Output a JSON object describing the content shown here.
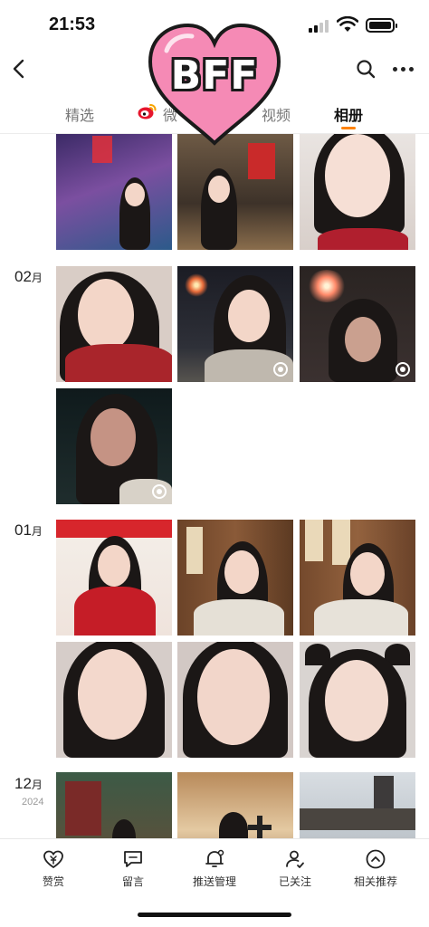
{
  "status_bar": {
    "time": "21:53"
  },
  "sticker": {
    "text": "BFF"
  },
  "tabs": [
    {
      "label": "精选"
    },
    {
      "label": "微"
    },
    {
      "label": "视频"
    },
    {
      "label": "相册"
    }
  ],
  "active_tab": "相册",
  "gallery": {
    "months": [
      {
        "month": "02",
        "unit": "月"
      },
      {
        "month": "01",
        "unit": "月"
      },
      {
        "month": "12",
        "unit": "月",
        "year": "2024"
      }
    ]
  },
  "bottom_bar": {
    "items": [
      {
        "label": "赞赏",
        "icon": "reward-icon"
      },
      {
        "label": "留言",
        "icon": "comment-icon"
      },
      {
        "label": "推送管理",
        "icon": "bell-settings-icon"
      },
      {
        "label": "已关注",
        "icon": "followed-user-icon"
      },
      {
        "label": "相关推荐",
        "icon": "chevron-up-circle-icon"
      }
    ]
  },
  "colors": {
    "accent": "#ff8200",
    "sticker_pink": "#f58ab5"
  }
}
